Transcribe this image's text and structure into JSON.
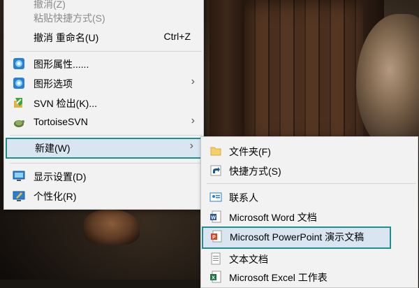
{
  "context_menu": {
    "items": [
      {
        "label": "撤消(Z)",
        "disabled": true
      },
      {
        "label": "粘贴快捷方式(S)",
        "disabled": true
      },
      {
        "label": "撤消 重命名(U)",
        "shortcut": "Ctrl+Z"
      },
      {
        "label": "图形属性......",
        "icon": "graphics-icon"
      },
      {
        "label": "图形选项",
        "icon": "graphics-icon",
        "has_submenu": true
      },
      {
        "label": "SVN 检出(K)...",
        "icon": "svn-checkout-icon"
      },
      {
        "label": "TortoiseSVN",
        "icon": "tortoisesvn-icon",
        "has_submenu": true
      },
      {
        "label": "新建(W)",
        "has_submenu": true,
        "highlighted": true
      },
      {
        "label": "显示设置(D)",
        "icon": "display-icon"
      },
      {
        "label": "个性化(R)",
        "icon": "personalize-icon"
      }
    ],
    "arrow_glyph": "›"
  },
  "new_submenu": {
    "items": [
      {
        "label": "文件夹(F)",
        "icon": "folder-icon"
      },
      {
        "label": "快捷方式(S)",
        "icon": "shortcut-icon"
      },
      {
        "label": "联系人",
        "icon": "contact-icon"
      },
      {
        "label": "Microsoft Word 文档",
        "icon": "word-icon"
      },
      {
        "label": "Microsoft PowerPoint 演示文稿",
        "icon": "powerpoint-icon",
        "highlighted": true
      },
      {
        "label": "文本文档",
        "icon": "text-doc-icon"
      },
      {
        "label": "Microsoft Excel 工作表",
        "icon": "excel-icon"
      }
    ]
  },
  "colors": {
    "highlight_border": "#1f8f8b",
    "menu_bg": "#f2f2f2"
  }
}
